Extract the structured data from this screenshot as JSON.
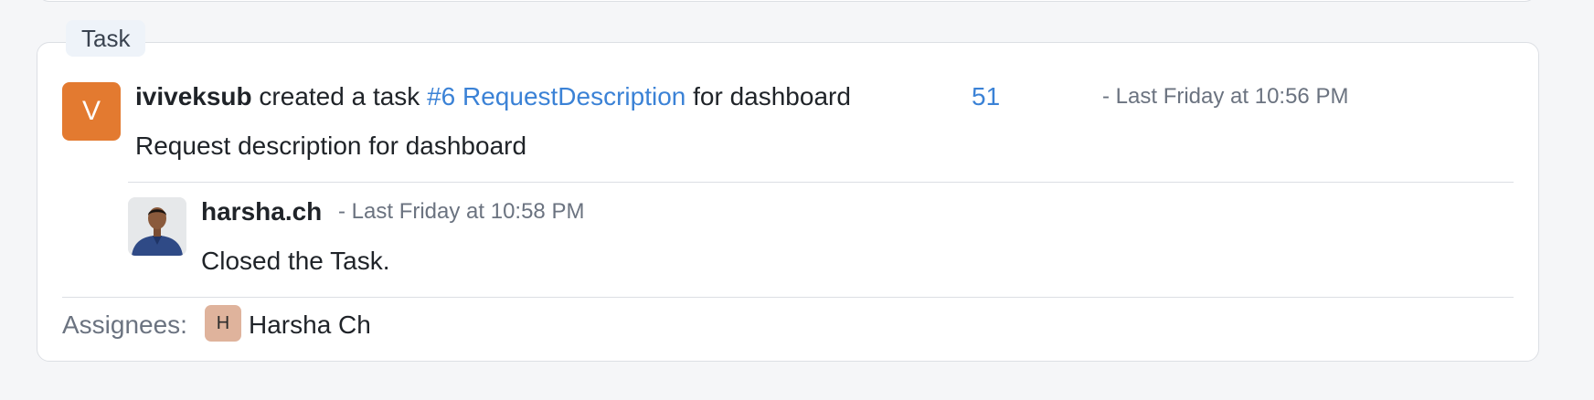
{
  "card": {
    "type_label": "Task",
    "avatar_initial": "V",
    "author": "iviveksub",
    "action_text": " created a task ",
    "task_link": "#6 RequestDescription",
    "target_text": " for dashboard",
    "count": "51",
    "timestamp": "- Last Friday at 10:56 PM",
    "description": "Request description for dashboard"
  },
  "comment": {
    "author": "harsha.ch",
    "timestamp": "- Last Friday at 10:58 PM",
    "text": "Closed the Task."
  },
  "assignees": {
    "label": "Assignees:",
    "items": [
      {
        "initial": "H",
        "name": "Harsha Ch"
      }
    ]
  },
  "colors": {
    "accent_link": "#3b82d6",
    "avatar_v": "#e37a30",
    "avatar_h": "#dfb39c"
  },
  "icons": {
    "commenter_avatar": "person-photo-avatar"
  }
}
